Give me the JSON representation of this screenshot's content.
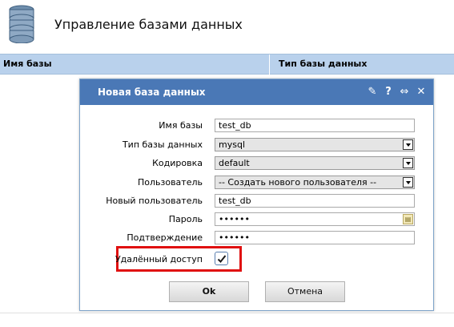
{
  "header": {
    "icon": "database-icon",
    "title": "Управление базами данных"
  },
  "table": {
    "columns": [
      "Имя базы",
      "Тип базы данных"
    ]
  },
  "dialog": {
    "title": "Новая база данных",
    "toolbar_icons": [
      "pin-icon",
      "help-icon",
      "maximize-icon",
      "close-icon"
    ],
    "toolbar_glyphs": {
      "pin": "✎",
      "help": "?",
      "maximize": "⇔",
      "close": "✕"
    },
    "fields": {
      "db_name": {
        "label": "Имя базы",
        "value": "test_db"
      },
      "db_type": {
        "label": "Тип базы данных",
        "value": "mysql"
      },
      "encoding": {
        "label": "Кодировка",
        "value": "default"
      },
      "user": {
        "label": "Пользователь",
        "value": "-- Создать нового пользователя --"
      },
      "new_user": {
        "label": "Новый пользователь",
        "value": "test_db"
      },
      "password": {
        "label": "Пароль",
        "value": "••••••"
      },
      "confirm": {
        "label": "Подтверждение",
        "value": "••••••"
      },
      "remote_access": {
        "label": "Удалённый доступ",
        "checked": true
      }
    },
    "buttons": {
      "ok": "Ok",
      "cancel": "Отмена"
    }
  },
  "colors": {
    "titlebar": "#4a78b6",
    "table_header": "#b9d1ec",
    "highlight": "#e01010"
  }
}
